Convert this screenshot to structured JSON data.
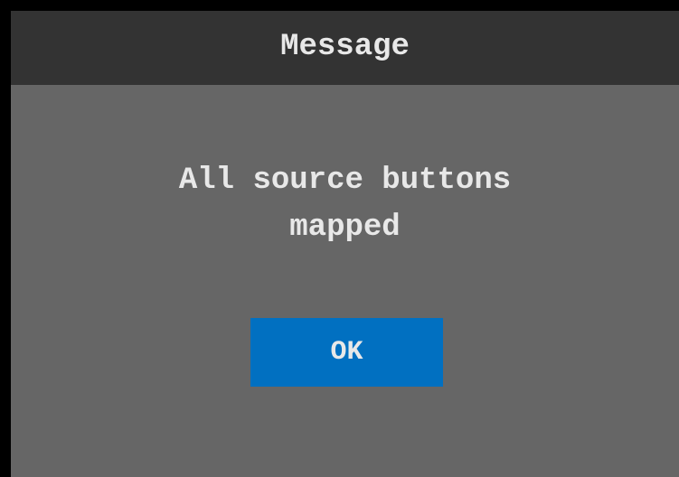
{
  "dialog": {
    "title": "Message",
    "message_lines": [
      "All source buttons",
      "mapped"
    ],
    "ok_label": "OK"
  },
  "colors": {
    "outer_background": "#000000",
    "title_bar": "#333333",
    "dialog_body": "#666666",
    "button": "#0170c1",
    "text": "#e8e8e8"
  }
}
